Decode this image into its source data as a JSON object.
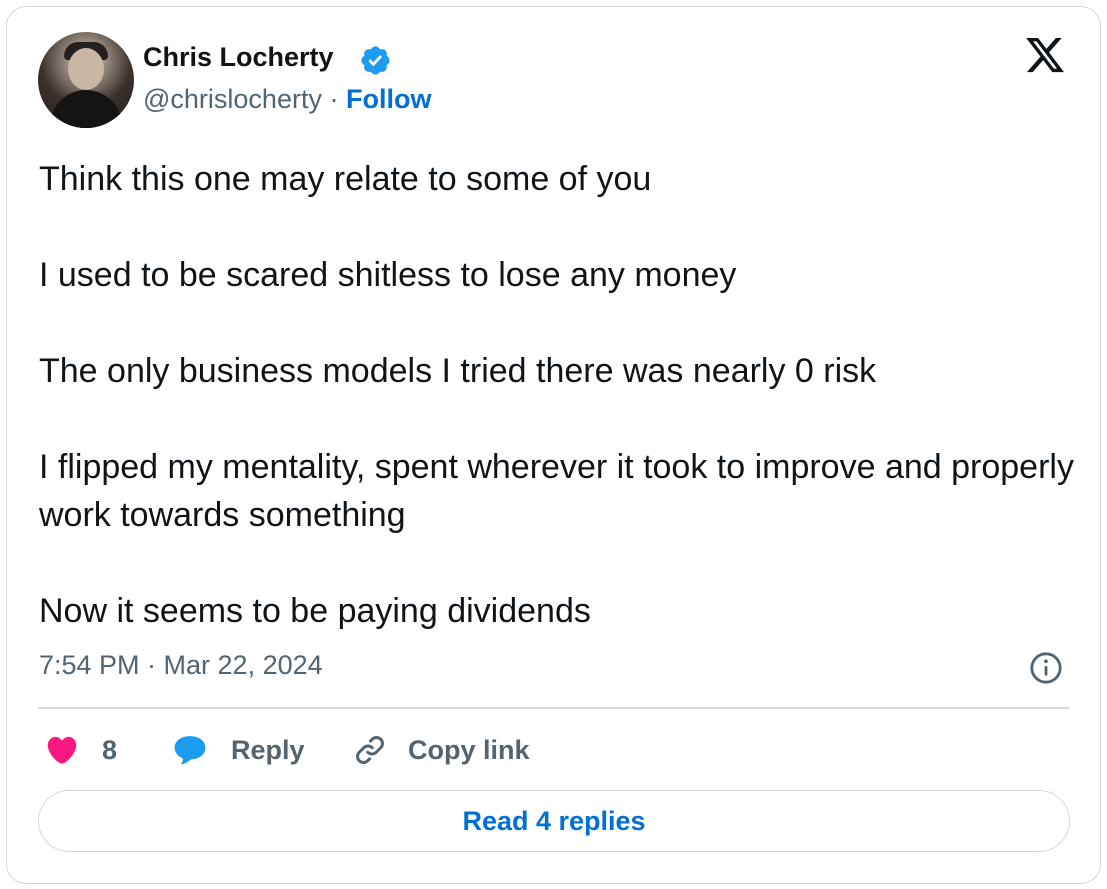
{
  "author": {
    "name": "Chris Locherty",
    "handle": "@chrislocherty",
    "separator": "·",
    "follow_label": "Follow",
    "verified_icon": "verified-badge-icon",
    "verified_color": "#1d9bf0"
  },
  "platform_icon": "x-logo-icon",
  "tweet": {
    "paragraphs": [
      "Think this one may relate to some of you",
      "I used to be scared shitless to lose any money",
      "The only business models I tried there was nearly 0 risk",
      "I flipped my mentality, spent wherever it took to improve and properly work towards something",
      "Now it seems to be paying dividends"
    ],
    "timestamp": "7:54 PM · Mar 22, 2024"
  },
  "actions": {
    "like_count": "8",
    "like_icon": "heart-icon",
    "like_color": "#f91880",
    "reply_label": "Reply",
    "reply_icon": "speech-bubble-icon",
    "reply_color": "#1d9bf0",
    "copy_label": "Copy link",
    "copy_icon": "link-icon"
  },
  "read_replies_label": "Read 4 replies",
  "accent_color": "#006fd6"
}
